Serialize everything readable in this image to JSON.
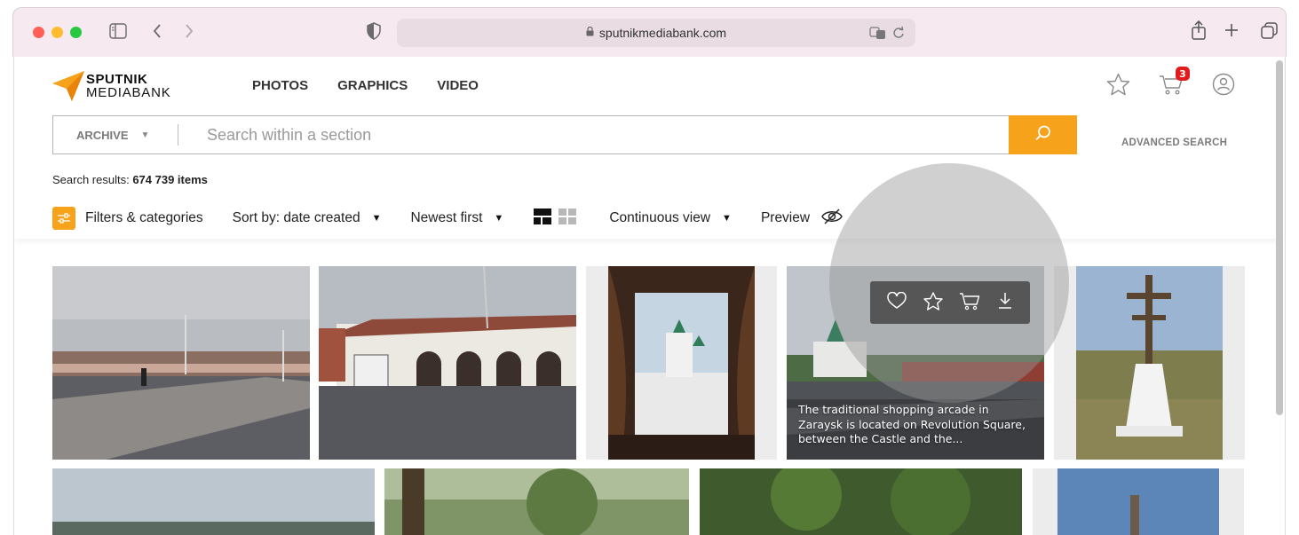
{
  "browser": {
    "url": "sputnikmediabank.com"
  },
  "header": {
    "logo_line1": "SPUTNIK",
    "logo_line2": "MEDIABANK",
    "nav": [
      "PHOTOS",
      "GRAPHICS",
      "VIDEO"
    ],
    "cart_count": "3"
  },
  "search": {
    "section": "ARCHIVE",
    "placeholder": "Search within a section",
    "advanced": "ADVANCED SEARCH"
  },
  "results": {
    "label": "Search results: ",
    "count": "674 739 items"
  },
  "toolbar": {
    "filters": "Filters & categories",
    "sort": "Sort by: date created",
    "order": "Newest first",
    "view_mode": "Continuous view",
    "preview": "Preview"
  },
  "hovered_photo": {
    "caption": "The traditional shopping arcade in Zaraysk is located on Revolution Square, between the Castle and the..."
  },
  "colors": {
    "accent": "#f7a21b",
    "badge": "#e21b1b"
  }
}
